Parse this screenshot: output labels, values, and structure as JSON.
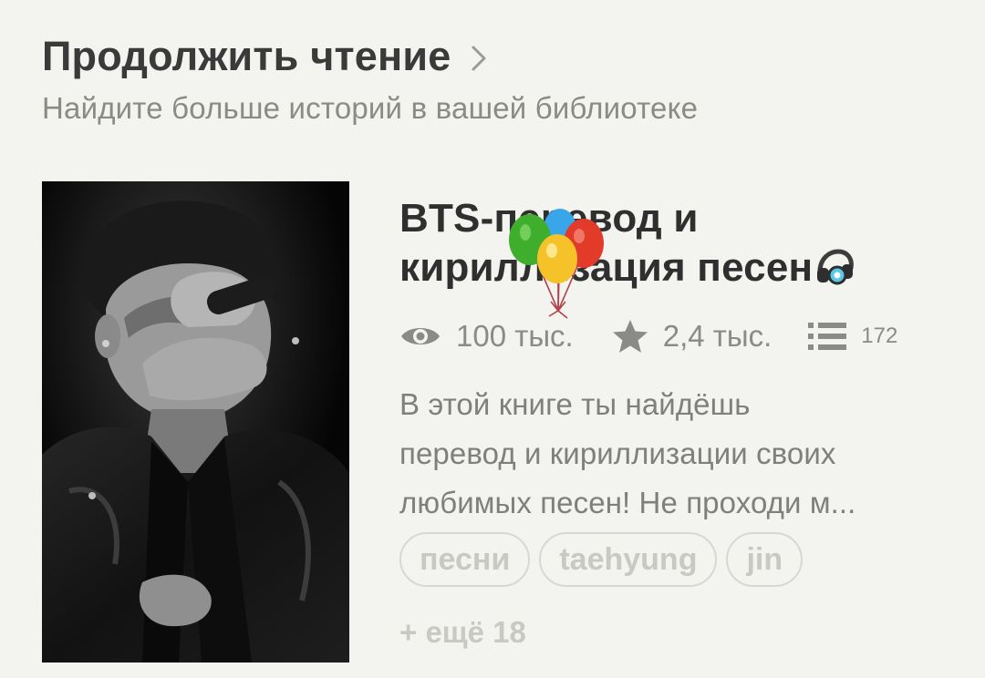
{
  "section": {
    "title": "Продолжить чтение",
    "subtitle": "Найдите больше историй в вашей библиотеке",
    "chevron_icon": "chevron-right-icon"
  },
  "book": {
    "title": "BTS-перевод и кириллизация песен",
    "title_decorations": [
      "balloons-icon",
      "headphones-icon"
    ],
    "cover_icon": "performer-photo",
    "stats": {
      "reads": {
        "icon": "eye-icon",
        "value": "100 тыс."
      },
      "votes": {
        "icon": "star-icon",
        "value": "2,4 тыс."
      },
      "parts": {
        "icon": "list-icon",
        "value": "172"
      }
    },
    "description_lines": [
      "В этой книге ты найдёшь",
      "перевод и кириллизации своих",
      "любимых песен! Не проходи м..."
    ],
    "tags": [
      "песни",
      "taehyung",
      "jin"
    ],
    "more_tags": "+ ещё 18"
  },
  "colors": {
    "background": "#f3f3ef",
    "title": "#3a3a3a",
    "subtitle": "#8b8b86",
    "tag_text": "#c9c9c4",
    "tag_border": "#d8d8d3"
  }
}
